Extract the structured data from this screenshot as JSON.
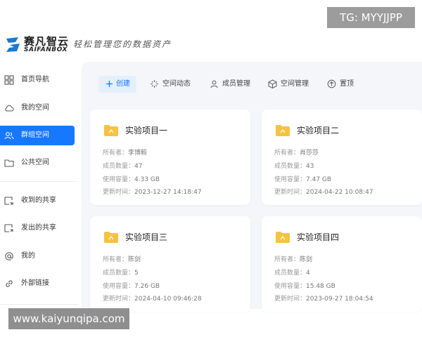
{
  "brand": {
    "name": "赛凡智云",
    "sub": "SAIFANBOX",
    "slogan": "轻松管理您的数据资产",
    "colors": {
      "primary": "#1677ff",
      "logo_blue": "#1a78d2",
      "folder": "#f5c242"
    }
  },
  "watermarks": {
    "tg": "TG: MYYJJPP",
    "url": "www.kaiyunqipa.com"
  },
  "sidebar": {
    "items": [
      {
        "label": "首页导航",
        "icon": "grid-icon",
        "active": false
      },
      {
        "label": "我的空间",
        "icon": "cloud-icon",
        "active": false
      },
      {
        "label": "群组空间",
        "icon": "group-icon",
        "active": true
      },
      {
        "label": "公共空间",
        "icon": "folder-icon",
        "active": false
      },
      {
        "label": "收到的共享",
        "icon": "share-in-icon",
        "active": false
      },
      {
        "label": "发出的共享",
        "icon": "share-out-icon",
        "active": false
      },
      {
        "label": "我的",
        "icon": "at-icon",
        "active": false
      },
      {
        "label": "外部链接",
        "icon": "link-icon",
        "active": false
      }
    ]
  },
  "toolbar": {
    "create": "创建",
    "dynamics": "空间动态",
    "members": "成员管理",
    "space_manage": "空间管理",
    "pin": "置顶"
  },
  "labels": {
    "owner": "所有者：",
    "member_count": "成员数量：",
    "usage": "使用容量：",
    "updated": "更新时间："
  },
  "cards": [
    {
      "title": "实验项目一",
      "owner": "李博毅",
      "members": "47",
      "usage": "4.33 GB",
      "updated": "2023-12-27 14:18:47"
    },
    {
      "title": "实验项目二",
      "owner": "肖莎莎",
      "members": "43",
      "usage": "7.47 GB",
      "updated": "2024-04-22 10:08:47"
    },
    {
      "title": "实验项目三",
      "owner": "陈剑",
      "members": "5",
      "usage": "7.26 GB",
      "updated": "2024-04-10 09:46:28"
    },
    {
      "title": "实验项目四",
      "owner": "陈剑",
      "members": "4",
      "usage": "15.48 GB",
      "updated": "2023-09-27 18:04:54"
    }
  ]
}
